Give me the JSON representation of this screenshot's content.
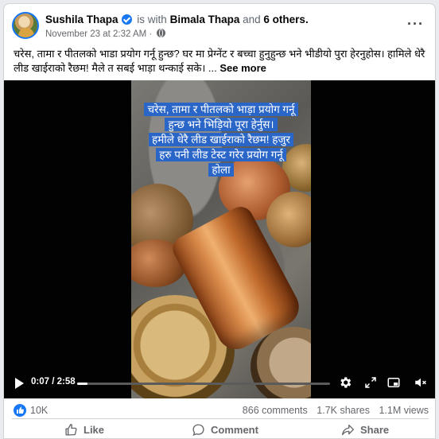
{
  "post": {
    "author": "Sushila Thapa",
    "with_prefix": "is with",
    "tagged": "Bimala Thapa",
    "and_word": "and",
    "others": "6 others.",
    "timestamp": "November 23 at 2:32 AM",
    "dot": "·",
    "caption": "चरेस, तामा र पीतलको भाडा प्रयोग गर्नू हुन्छ? घर मा प्रेग्नेंट र बच्चा हुनुहुन्छ भने भीडीयो पुरा हेरनुहोस। हामिले धेरै लीड खाईराको रैछम! मैले त सबई भाड़ा थन्काई सके। ...",
    "see_more": "See more"
  },
  "video": {
    "overlay_lines": [
      "चरेस, तामा र पीतलको भाड़ा प्रयोग गर्नू",
      "हुन्छ भने भिड़ियो पूरा हेर्नुस।",
      "हमीले धेरै लीड खाईराको रैछम! हजुर",
      "हरु पनी लीड टेस्ट गरेर प्रयोग गर्नू",
      "होला"
    ],
    "time": "0:07 / 2:58",
    "progress": 0.04
  },
  "stats": {
    "reactions": "10K",
    "comments": "866 comments",
    "shares": "1.7K shares",
    "views": "1.1M views"
  },
  "actions": {
    "like": "Like",
    "comment": "Comment",
    "share": "Share"
  },
  "icons": {
    "more": "more-options-icon",
    "verified": "verified-badge-icon",
    "globe": "globe-icon",
    "play": "play-icon",
    "settings": "gear-icon",
    "fullscreen": "expand-icon",
    "pip": "picture-in-picture-icon",
    "volume": "volume-muted-icon"
  },
  "colors": {
    "brand": "#1877f2",
    "overlay_highlight": "#2a66c8"
  }
}
